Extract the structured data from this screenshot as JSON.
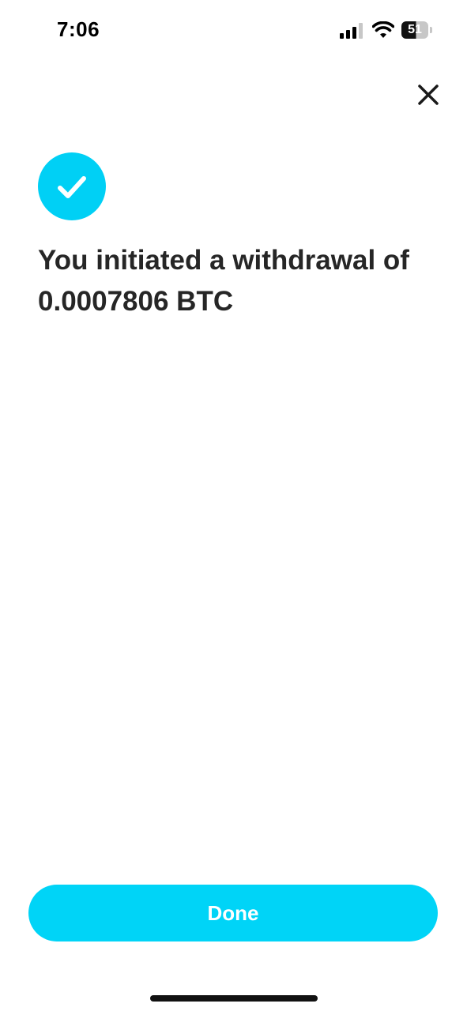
{
  "status_bar": {
    "time": "7:06",
    "battery_level": "51",
    "signal_icon": "cellular-signal-icon",
    "wifi_icon": "wifi-icon"
  },
  "header": {
    "close_icon": "close-icon"
  },
  "confirmation": {
    "badge_icon": "checkmark-icon",
    "badge_color": "#00d0f5",
    "headline": "You initiated a withdrawal of 0.0007806 BTC"
  },
  "footer": {
    "done_label": "Done",
    "button_color": "#00d4f7"
  }
}
